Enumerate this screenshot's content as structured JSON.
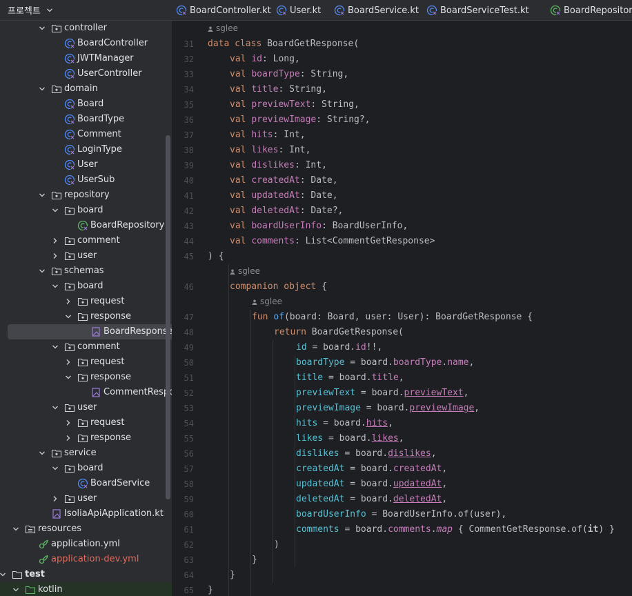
{
  "sidebar": {
    "title": "프로젝트",
    "tree": [
      {
        "label": "controller",
        "type": "package",
        "indent": 1,
        "arrow": "down"
      },
      {
        "label": "BoardController",
        "type": "class",
        "indent": 2
      },
      {
        "label": "JWTManager",
        "type": "class",
        "indent": 2
      },
      {
        "label": "UserController",
        "type": "class",
        "indent": 2
      },
      {
        "label": "domain",
        "type": "package",
        "indent": 1,
        "arrow": "down"
      },
      {
        "label": "Board",
        "type": "class",
        "indent": 2
      },
      {
        "label": "BoardType",
        "type": "class",
        "indent": 2
      },
      {
        "label": "Comment",
        "type": "class",
        "indent": 2
      },
      {
        "label": "LoginType",
        "type": "class",
        "indent": 2
      },
      {
        "label": "User",
        "type": "class",
        "indent": 2
      },
      {
        "label": "UserSub",
        "type": "class",
        "indent": 2
      },
      {
        "label": "repository",
        "type": "package",
        "indent": 1,
        "arrow": "down"
      },
      {
        "label": "board",
        "type": "package",
        "indent": 2,
        "arrow": "down"
      },
      {
        "label": "BoardRepository",
        "type": "interface",
        "indent": 3
      },
      {
        "label": "comment",
        "type": "package",
        "indent": 2,
        "arrow": "right"
      },
      {
        "label": "user",
        "type": "package",
        "indent": 2,
        "arrow": "right"
      },
      {
        "label": "schemas",
        "type": "package",
        "indent": 1,
        "arrow": "down"
      },
      {
        "label": "board",
        "type": "package",
        "indent": 2,
        "arrow": "down"
      },
      {
        "label": "request",
        "type": "package",
        "indent": 3,
        "arrow": "right"
      },
      {
        "label": "response",
        "type": "package",
        "indent": 3,
        "arrow": "down"
      },
      {
        "label": "BoardResponse.kt",
        "type": "kotlin-file",
        "indent": 4,
        "selected": true
      },
      {
        "label": "comment",
        "type": "package",
        "indent": 2,
        "arrow": "down"
      },
      {
        "label": "request",
        "type": "package",
        "indent": 3,
        "arrow": "right"
      },
      {
        "label": "response",
        "type": "package",
        "indent": 3,
        "arrow": "down"
      },
      {
        "label": "CommentResponse.kt",
        "type": "kotlin-file",
        "indent": 4
      },
      {
        "label": "user",
        "type": "package",
        "indent": 2,
        "arrow": "down"
      },
      {
        "label": "request",
        "type": "package",
        "indent": 3,
        "arrow": "right"
      },
      {
        "label": "response",
        "type": "package",
        "indent": 3,
        "arrow": "right"
      },
      {
        "label": "service",
        "type": "package",
        "indent": 1,
        "arrow": "down"
      },
      {
        "label": "board",
        "type": "package",
        "indent": 2,
        "arrow": "down"
      },
      {
        "label": "BoardService",
        "type": "class",
        "indent": 3
      },
      {
        "label": "user",
        "type": "package",
        "indent": 2,
        "arrow": "right"
      },
      {
        "label": "IsoliaApiApplication.kt",
        "type": "kotlin-file",
        "indent": 1
      },
      {
        "label": "resources",
        "type": "resources-folder",
        "indent": -1,
        "arrow": "down"
      },
      {
        "label": "application.yml",
        "type": "yml",
        "indent": 0
      },
      {
        "label": "application-dev.yml",
        "type": "yml",
        "indent": 0,
        "color": "red"
      },
      {
        "label": "test",
        "type": "folder",
        "indent": -2,
        "arrow": "down",
        "bold": true
      },
      {
        "label": "kotlin",
        "type": "test-folder",
        "indent": -1,
        "arrow": "down",
        "highlight": true
      }
    ]
  },
  "tabs": [
    {
      "label": "BoardController.kt",
      "icon": "class-icon"
    },
    {
      "label": "User.kt",
      "icon": "class-icon"
    },
    {
      "label": "BoardService.kt",
      "icon": "class-icon"
    },
    {
      "label": "BoardServiceTest.kt",
      "icon": "class-icon"
    },
    {
      "label": "BoardRepository.kt",
      "icon": "interface-icon"
    }
  ],
  "editor": {
    "author_hint": "sglee",
    "lines": [
      {
        "type": "hint",
        "text": "sglee",
        "indent": 0
      },
      {
        "type": "code",
        "n": "31",
        "indent": 0,
        "tokens": [
          [
            "kw",
            "data class "
          ],
          [
            "plain",
            "BoardGetResponse("
          ]
        ]
      },
      {
        "type": "code",
        "n": "32",
        "indent": 1,
        "tokens": [
          [
            "kw",
            "val "
          ],
          [
            "prop",
            "id"
          ],
          [
            "plain",
            ": Long,"
          ]
        ]
      },
      {
        "type": "code",
        "n": "33",
        "indent": 1,
        "tokens": [
          [
            "kw",
            "val "
          ],
          [
            "prop",
            "boardType"
          ],
          [
            "plain",
            ": String,"
          ]
        ]
      },
      {
        "type": "code",
        "n": "34",
        "indent": 1,
        "tokens": [
          [
            "kw",
            "val "
          ],
          [
            "prop",
            "title"
          ],
          [
            "plain",
            ": String,"
          ]
        ]
      },
      {
        "type": "code",
        "n": "35",
        "indent": 1,
        "tokens": [
          [
            "kw",
            "val "
          ],
          [
            "prop",
            "previewText"
          ],
          [
            "plain",
            ": String,"
          ]
        ]
      },
      {
        "type": "code",
        "n": "36",
        "indent": 1,
        "tokens": [
          [
            "kw",
            "val "
          ],
          [
            "prop",
            "previewImage"
          ],
          [
            "plain",
            ": String?,"
          ]
        ]
      },
      {
        "type": "code",
        "n": "37",
        "indent": 1,
        "tokens": [
          [
            "kw",
            "val "
          ],
          [
            "prop",
            "hits"
          ],
          [
            "plain",
            ": Int,"
          ]
        ]
      },
      {
        "type": "code",
        "n": "38",
        "indent": 1,
        "tokens": [
          [
            "kw",
            "val "
          ],
          [
            "prop",
            "likes"
          ],
          [
            "plain",
            ": Int,"
          ]
        ]
      },
      {
        "type": "code",
        "n": "39",
        "indent": 1,
        "tokens": [
          [
            "kw",
            "val "
          ],
          [
            "prop",
            "dislikes"
          ],
          [
            "plain",
            ": Int,"
          ]
        ]
      },
      {
        "type": "code",
        "n": "40",
        "indent": 1,
        "tokens": [
          [
            "kw",
            "val "
          ],
          [
            "prop",
            "createdAt"
          ],
          [
            "plain",
            ": Date,"
          ]
        ]
      },
      {
        "type": "code",
        "n": "41",
        "indent": 1,
        "tokens": [
          [
            "kw",
            "val "
          ],
          [
            "prop",
            "updatedAt"
          ],
          [
            "plain",
            ": Date,"
          ]
        ]
      },
      {
        "type": "code",
        "n": "42",
        "indent": 1,
        "tokens": [
          [
            "kw",
            "val "
          ],
          [
            "prop",
            "deletedAt"
          ],
          [
            "plain",
            ": Date?,"
          ]
        ]
      },
      {
        "type": "code",
        "n": "43",
        "indent": 1,
        "tokens": [
          [
            "kw",
            "val "
          ],
          [
            "prop",
            "boardUserInfo"
          ],
          [
            "plain",
            ": BoardUserInfo,"
          ]
        ]
      },
      {
        "type": "code",
        "n": "44",
        "indent": 1,
        "tokens": [
          [
            "kw",
            "val "
          ],
          [
            "prop",
            "comments"
          ],
          [
            "plain",
            ": List<CommentGetResponse>"
          ]
        ]
      },
      {
        "type": "code",
        "n": "45",
        "indent": 0,
        "tokens": [
          [
            "plain",
            ") {"
          ]
        ]
      },
      {
        "type": "hint",
        "text": "sglee",
        "indent": 1
      },
      {
        "type": "code",
        "n": "46",
        "indent": 1,
        "tokens": [
          [
            "kw",
            "companion object "
          ],
          [
            "plain",
            "{"
          ]
        ]
      },
      {
        "type": "hint",
        "text": "sglee",
        "indent": 2
      },
      {
        "type": "code",
        "n": "47",
        "indent": 2,
        "tokens": [
          [
            "kw",
            "fun "
          ],
          [
            "fn",
            "of"
          ],
          [
            "plain",
            "(board: Board, user: User): BoardGetResponse {"
          ]
        ]
      },
      {
        "type": "code",
        "n": "48",
        "indent": 3,
        "tokens": [
          [
            "kw",
            "return "
          ],
          [
            "plain",
            "BoardGetResponse("
          ]
        ]
      },
      {
        "type": "code",
        "n": "49",
        "indent": 4,
        "tokens": [
          [
            "named",
            "id"
          ],
          [
            "plain",
            " = board."
          ],
          [
            "prop",
            "id"
          ],
          [
            "plain",
            "!!,"
          ]
        ]
      },
      {
        "type": "code",
        "n": "50",
        "indent": 4,
        "tokens": [
          [
            "named",
            "boardType"
          ],
          [
            "plain",
            " = board."
          ],
          [
            "prop",
            "boardType"
          ],
          [
            "plain",
            "."
          ],
          [
            "prop",
            "name"
          ],
          [
            "plain",
            ","
          ]
        ]
      },
      {
        "type": "code",
        "n": "51",
        "indent": 4,
        "tokens": [
          [
            "named",
            "title"
          ],
          [
            "plain",
            " = board."
          ],
          [
            "prop",
            "title"
          ],
          [
            "plain",
            ","
          ]
        ]
      },
      {
        "type": "code",
        "n": "52",
        "indent": 4,
        "tokens": [
          [
            "named",
            "previewText"
          ],
          [
            "plain",
            " = board."
          ],
          [
            "propu",
            "previewText"
          ],
          [
            "plain",
            ","
          ]
        ]
      },
      {
        "type": "code",
        "n": "53",
        "indent": 4,
        "tokens": [
          [
            "named",
            "previewImage"
          ],
          [
            "plain",
            " = board."
          ],
          [
            "propu",
            "previewImage"
          ],
          [
            "plain",
            ","
          ]
        ]
      },
      {
        "type": "code",
        "n": "54",
        "indent": 4,
        "tokens": [
          [
            "named",
            "hits"
          ],
          [
            "plain",
            " = board."
          ],
          [
            "propu",
            "hits"
          ],
          [
            "plain",
            ","
          ]
        ]
      },
      {
        "type": "code",
        "n": "55",
        "indent": 4,
        "tokens": [
          [
            "named",
            "likes"
          ],
          [
            "plain",
            " = board."
          ],
          [
            "propu",
            "likes"
          ],
          [
            "plain",
            ","
          ]
        ]
      },
      {
        "type": "code",
        "n": "56",
        "indent": 4,
        "tokens": [
          [
            "named",
            "dislikes"
          ],
          [
            "plain",
            " = board."
          ],
          [
            "propu",
            "dislikes"
          ],
          [
            "plain",
            ","
          ]
        ]
      },
      {
        "type": "code",
        "n": "57",
        "indent": 4,
        "tokens": [
          [
            "named",
            "createdAt"
          ],
          [
            "plain",
            " = board."
          ],
          [
            "prop",
            "createdAt"
          ],
          [
            "plain",
            ","
          ]
        ]
      },
      {
        "type": "code",
        "n": "58",
        "indent": 4,
        "tokens": [
          [
            "named",
            "updatedAt"
          ],
          [
            "plain",
            " = board."
          ],
          [
            "propu",
            "updatedAt"
          ],
          [
            "plain",
            ","
          ]
        ]
      },
      {
        "type": "code",
        "n": "59",
        "indent": 4,
        "tokens": [
          [
            "named",
            "deletedAt"
          ],
          [
            "plain",
            " = board."
          ],
          [
            "propu",
            "deletedAt"
          ],
          [
            "plain",
            ","
          ]
        ]
      },
      {
        "type": "code",
        "n": "60",
        "indent": 4,
        "tokens": [
          [
            "named",
            "boardUserInfo"
          ],
          [
            "plain",
            " = BoardUserInfo.of(user),"
          ]
        ]
      },
      {
        "type": "code",
        "n": "61",
        "indent": 4,
        "tokens": [
          [
            "named",
            "comments"
          ],
          [
            "plain",
            " = board."
          ],
          [
            "prop",
            "comments"
          ],
          [
            "plain",
            "."
          ],
          [
            "it",
            "map"
          ],
          [
            "plain",
            " { CommentGetResponse.of("
          ],
          [
            "bd",
            "it"
          ],
          [
            "plain",
            ") }"
          ]
        ]
      },
      {
        "type": "code",
        "n": "62",
        "indent": 3,
        "tokens": [
          [
            "plain",
            ")"
          ]
        ]
      },
      {
        "type": "code",
        "n": "63",
        "indent": 2,
        "tokens": [
          [
            "plain",
            "}"
          ]
        ]
      },
      {
        "type": "code",
        "n": "64",
        "indent": 1,
        "tokens": [
          [
            "plain",
            "}"
          ]
        ]
      },
      {
        "type": "code",
        "n": "65",
        "indent": 0,
        "tokens": [
          [
            "plain",
            "}"
          ]
        ]
      }
    ]
  },
  "colors": {
    "keyword": "#cf8e6d",
    "property": "#c77dbb",
    "function": "#56a8f5",
    "named_arg": "#56c1d6",
    "text": "#bcbec4",
    "class_icon": "#548af7",
    "interface_icon": "#5fb865",
    "kotlin_icon": "#9b7bd8",
    "error_text": "#e46a5e"
  }
}
